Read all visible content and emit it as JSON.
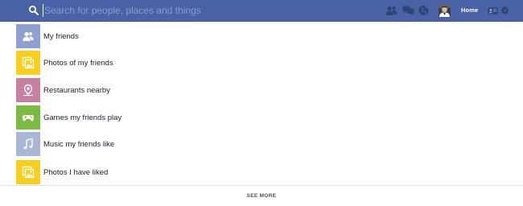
{
  "search": {
    "placeholder": "Search for people, places and things"
  },
  "header": {
    "home_label": "Home"
  },
  "icons": {
    "search": "search-icon",
    "friend_requests": "friend-requests-icon",
    "messages": "messages-icon",
    "notifications": "notifications-globe-icon",
    "avatar": "profile-avatar",
    "privacy": "privacy-shortcuts-icon",
    "settings": "gear-icon"
  },
  "colors": {
    "topbar": "#4a62a6",
    "friends_tile": "#8f9fd1",
    "photos_tile": "#f9cf1e",
    "restaurants_tile": "#c780a1",
    "games_tile": "#7cbb42",
    "music_tile": "#aab6d6"
  },
  "suggestions": [
    {
      "label": "My friends",
      "icon": "friends-icon",
      "color": "#8f9fd1"
    },
    {
      "label": "Photos of my friends",
      "icon": "photos-icon",
      "color": "#f9cf1e"
    },
    {
      "label": "Restaurants nearby",
      "icon": "map-pin-icon",
      "color": "#c780a1"
    },
    {
      "label": "Games my friends play",
      "icon": "game-controller-icon",
      "color": "#7cbb42"
    },
    {
      "label": "Music my friends like",
      "icon": "music-note-icon",
      "color": "#aab6d6"
    },
    {
      "label": "Photos I have liked",
      "icon": "photos-icon",
      "color": "#f9cf1e"
    }
  ],
  "footer": {
    "see_more_label": "SEE MORE"
  }
}
